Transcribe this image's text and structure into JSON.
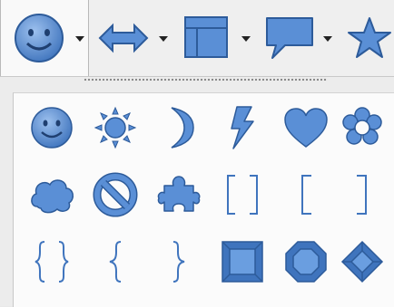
{
  "colors": {
    "fill": "#4a80c7",
    "fill_light": "#8db1e2",
    "stroke": "#2d5b9a",
    "panel_bg": "#fbfbfb",
    "toolbar_bg": "#efefef"
  },
  "toolbar": {
    "buttons": [
      {
        "icon": "smiley-face-icon",
        "dropdown": true,
        "active": true
      },
      {
        "icon": "double-arrow-icon",
        "dropdown": true,
        "active": false
      },
      {
        "icon": "flowchart-process-icon",
        "dropdown": true,
        "active": false
      },
      {
        "icon": "speech-callout-icon",
        "dropdown": true,
        "active": false
      },
      {
        "icon": "star-icon",
        "dropdown": false,
        "active": false
      }
    ]
  },
  "palette": {
    "rows": [
      [
        "smiley-face-icon",
        "sun-icon",
        "moon-icon",
        "lightning-icon",
        "heart-icon",
        "flower-icon"
      ],
      [
        "cloud-icon",
        "no-symbol-icon",
        "puzzle-icon",
        "double-bracket-icon",
        "left-bracket-icon",
        "right-bracket-icon"
      ],
      [
        "double-brace-icon",
        "left-brace-icon",
        "right-brace-icon",
        "square-bevel-icon",
        "octagon-bevel-icon",
        "diamond-bevel-icon"
      ]
    ]
  }
}
